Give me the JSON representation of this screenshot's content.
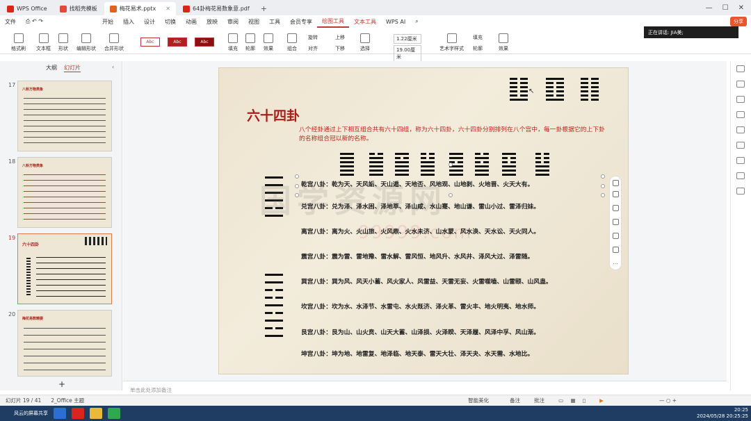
{
  "tabs": [
    {
      "label": "WPS Office",
      "color": "#d8261b"
    },
    {
      "label": "找稻壳模板",
      "color": "#e24a3b"
    },
    {
      "label": "梅花易术.pptx",
      "color": "#e0621c"
    },
    {
      "label": "64卦梅花易数象意.pdf",
      "color": "#d8261b"
    }
  ],
  "menu": {
    "file": "文件",
    "items": [
      "开始",
      "插入",
      "设计",
      "切换",
      "动画",
      "放映",
      "审阅",
      "视图",
      "工具",
      "会员专享",
      "绘图工具",
      "文本工具"
    ],
    "active": "绘图工具",
    "ai": "WPS AI"
  },
  "share": "分享",
  "ribbon": {
    "format_painter": "格式刷",
    "textbox": "文本框",
    "shape": "形状",
    "edit_shape": "编辑形状",
    "merge_shape": "合并形状",
    "style_samples": [
      "Abc",
      "Abc",
      "Abc"
    ],
    "fill": "填充",
    "outline": "轮廓",
    "effect": "效果",
    "group": "组合",
    "rotate": "旋转",
    "align": "对齐",
    "up": "上移",
    "down": "下移",
    "select": "选择",
    "height": "1.22厘米",
    "width": "19.00厘米",
    "art_text": "艺术字样式",
    "text_fill": "填充",
    "text_outline": "轮廓",
    "text_effect": "效果"
  },
  "speaking": "正在讲话: JIA美;",
  "left_panel": {
    "tab_outline": "大纲",
    "tab_slides": "幻灯片",
    "slides": [
      {
        "num": "17",
        "title": "八卦万物类象"
      },
      {
        "num": "18",
        "title": "八卦万物类象"
      },
      {
        "num": "19",
        "title": "六十四卦"
      },
      {
        "num": "20",
        "title": "梅花易数精要"
      }
    ],
    "add": "+"
  },
  "slide": {
    "title": "六十四卦",
    "intro": "八个经卦通过上下相互组合共有六十四组，称为六十四卦，六十四卦分别排列在八个宫中，每一卦根据它的上下卦的名称组合冠以新的名称。",
    "rows": [
      "乾宫八卦：乾为天、天风姤、天山遁、天地否、风地观、山地剥、火地晋、火天大有。",
      "兑宫八卦：兑为泽、泽水困、泽地萃、泽山咸、水山蹇、地山谦、雷山小过、雷泽归妹。",
      "离宫八卦：离为火、火山旅、火风鼎、火水未济、山水蒙、风水涣、天水讼、天火同人。",
      "震宫八卦：震为雷、雷地豫、雷水解、雷风恒、地风升、水风井、泽风大过、泽雷随。",
      "巽宫八卦：巽为风、风天小蓄、风火家人、风雷益、天雷无妄、火雷噬嗑、山雷颐、山风蛊。",
      "坎宫八卦：坎为水、水泽节、水雷屯、水火既济、泽火革、雷火丰、地火明夷、地水师。",
      "艮宫八卦：艮为山、山火贲、山天大蓄、山泽损、火泽睽、天泽履、风泽中孚、风山渐。",
      "坤宫八卦：坤为地、地雷复、地泽临、地天泰、雷天大壮、泽天夬、水天需、水地比。"
    ],
    "watermark": "国学资源网",
    "watermark_url": "99999.com"
  },
  "notes_placeholder": "单击此处添加备注",
  "status": {
    "slide_count": "幻灯片 19 / 41",
    "theme": "2_Office 主题",
    "smart_beautify": "智能美化",
    "notes": "备注",
    "comments": "批注"
  },
  "taskbar": {
    "item": "风云的屏幕共享",
    "time": "20:25",
    "date": "2024/05/28 20:25:25"
  }
}
